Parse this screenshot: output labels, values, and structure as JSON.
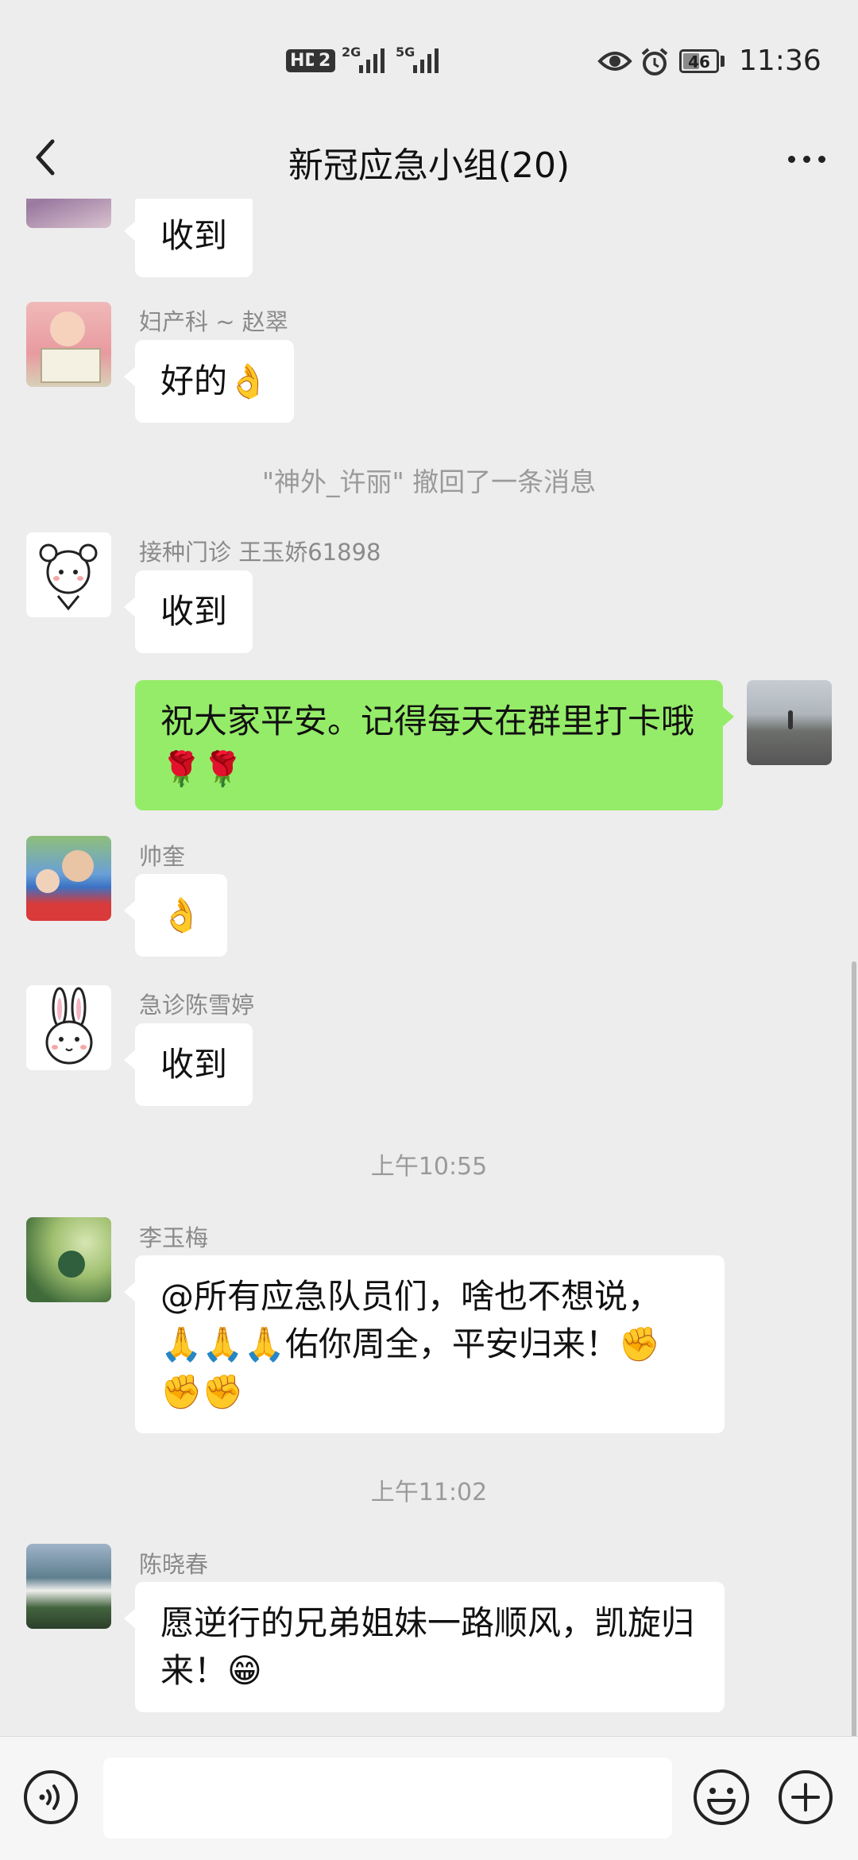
{
  "status_bar": {
    "hd": "HD",
    "sim2": "2",
    "net1": "2G",
    "net2": "5G",
    "battery": "46",
    "time": "11:36",
    "icons": [
      "eye-icon",
      "alarm-icon"
    ]
  },
  "nav": {
    "back_icon": "chevron-left-icon",
    "title": "新冠应急小组(20)",
    "more_icon": "more-dots-icon"
  },
  "messages": [
    {
      "sender": "",
      "text": "收到"
    },
    {
      "sender": "妇产科 ~ 赵翠",
      "text": "好的👌"
    },
    {
      "system": "\"神外_许丽\" 撤回了一条消息"
    },
    {
      "sender": "接种门诊 王玉娇61898",
      "text": "收到"
    },
    {
      "sender": "me",
      "text": "祝大家平安。记得每天在群里打卡哦🌹🌹"
    },
    {
      "sender": "帅奎",
      "text": "👌"
    },
    {
      "sender": "急诊陈雪婷",
      "text": "收到"
    },
    {
      "timestamp": "上午10:55"
    },
    {
      "sender": "李玉梅",
      "text": "@所有应急队员们，啥也不想说，🙏🙏🙏佑你周全，平安归来！✊✊✊"
    },
    {
      "timestamp": "上午11:02"
    },
    {
      "sender": "陈晓春",
      "text": "愿逆行的兄弟姐妹一路顺风，凯旋归来！😁"
    }
  ],
  "input_bar": {
    "voice_icon": "voice-icon",
    "text_value": "",
    "emoji_icon": "emoji-icon",
    "plus_icon": "plus-icon"
  },
  "colors": {
    "background": "#ededed",
    "my_bubble": "#95ec69",
    "other_bubble": "#ffffff",
    "meta_text": "#8a8a8a"
  }
}
